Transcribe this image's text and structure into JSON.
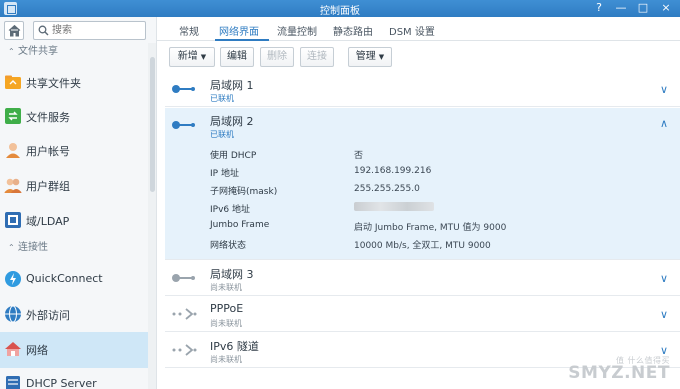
{
  "window": {
    "title": "控制面板",
    "buttons": [
      "?",
      "—",
      "□",
      "×"
    ]
  },
  "sidebar": {
    "search_placeholder": "搜索",
    "sections": [
      {
        "label": "文件共享"
      },
      {
        "label": "连接性"
      }
    ],
    "items": [
      {
        "label": "共享文件夹",
        "icon": "shared-folder-icon",
        "color": "#f39c2c"
      },
      {
        "label": "文件服务",
        "icon": "file-services-icon",
        "color": "#3fae49"
      },
      {
        "label": "用户帐号",
        "icon": "user-icon",
        "color": "#e48a3c"
      },
      {
        "label": "用户群组",
        "icon": "group-icon",
        "color": "#e48a3c"
      },
      {
        "label": "域/LDAP",
        "icon": "domain-icon",
        "color": "#2f6db3"
      },
      {
        "label": "QuickConnect",
        "icon": "quickconnect-icon",
        "color": "#2f9be0"
      },
      {
        "label": "外部访问",
        "icon": "globe-icon",
        "color": "#2f7cc2"
      },
      {
        "label": "网络",
        "icon": "network-home-icon",
        "color": "#d9534f"
      },
      {
        "label": "DHCP Server",
        "icon": "dhcp-server-icon",
        "color": "#2f6db3"
      }
    ],
    "active_index": 7
  },
  "tabs": [
    "常规",
    "网络界面",
    "流量控制",
    "静态路由",
    "DSM 设置"
  ],
  "active_tab": 1,
  "toolbar": {
    "create": "新增",
    "edit": "编辑",
    "delete": "删除",
    "connect": "连接",
    "manage": "管理"
  },
  "interfaces": [
    {
      "name": "局域网 1",
      "status": "已联机",
      "connected": true
    },
    {
      "name": "局域网 2",
      "status": "已联机",
      "connected": true,
      "details": [
        {
          "key": "使用 DHCP",
          "value": "否"
        },
        {
          "key": "IP 地址",
          "value": "192.168.199.216"
        },
        {
          "key": "子网掩码(mask)",
          "value": "255.255.255.0"
        },
        {
          "key": "IPv6 地址",
          "value": ""
        },
        {
          "key": "Jumbo Frame",
          "value": "启动 Jumbo Frame, MTU 值为 9000"
        },
        {
          "key": "网络状态",
          "value": "10000 Mb/s, 全双工, MTU 9000"
        }
      ]
    },
    {
      "name": "局域网 3",
      "status": "尚未联机",
      "connected": false
    },
    {
      "name": "PPPoE",
      "status": "尚未联机",
      "connected": false
    },
    {
      "name": "IPv6 隧道",
      "status": "尚未联机",
      "connected": false
    }
  ],
  "colors": {
    "accent": "#2f7cc2",
    "connected": "#2f7cc2",
    "disconnected": "#9aa4ad"
  },
  "watermark": {
    "text": "SMYZ.NET",
    "sub": "值 什么值得买"
  }
}
